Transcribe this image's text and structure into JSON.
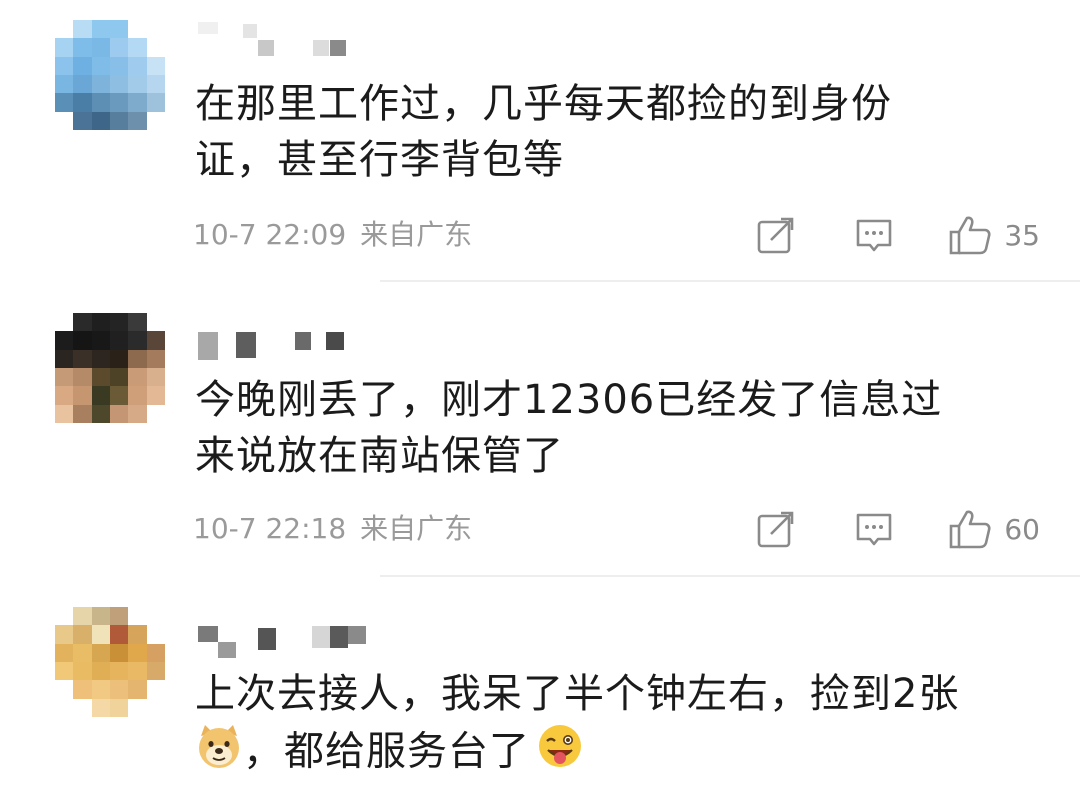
{
  "comments": [
    {
      "text_line1": "在那里工作过，几乎每天都捡的到身份",
      "text_line2": "证，甚至行李背包等",
      "time": "10-7 22:09",
      "location": "来自广东",
      "like_count": "35"
    },
    {
      "text_line1": "今晚刚丢了，刚才12306已经发了信息过",
      "text_line2": "来说放在南站保管了",
      "time": "10-7 22:18",
      "location": "来自广东",
      "like_count": "60"
    },
    {
      "text_line1": "上次去接人，我呆了半个钟左右，捡到2张",
      "text_line2_part": "，都给服务台了",
      "emoji1": "doge-emoji",
      "emoji2": "tongue-wink-emoji"
    }
  ],
  "icons": {
    "share": "share-icon",
    "reply": "comment-icon",
    "like": "thumbs-up-icon"
  },
  "colors": {
    "text": "#1b1b1b",
    "meta": "#9a9a9a",
    "icon": "#8a8a8a",
    "divider": "#eeeeee"
  }
}
